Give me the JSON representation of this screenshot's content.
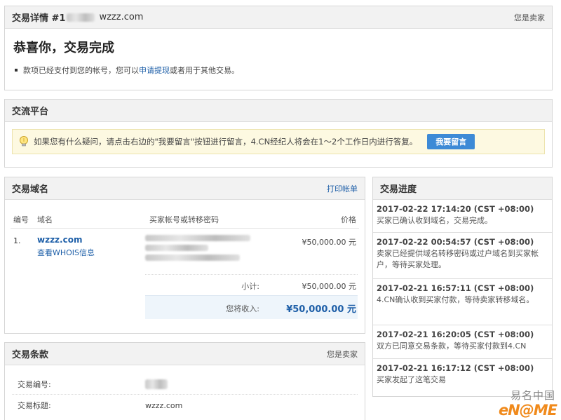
{
  "transaction": {
    "title_prefix": "交易详情 #1",
    "title_domain": "wzzz.com",
    "role": "您是卖家",
    "congrats": "恭喜你，交易完成",
    "note_before": "款项已经支付到您的帐号，您可以",
    "note_link": "申请提现",
    "note_after": "或者用于其他交易。"
  },
  "exchange": {
    "title": "交流平台",
    "notice": "如果您有什么疑问，请点击右边的\"我要留言\"按钮进行留言，4.CN经纪人将会在1～2个工作日内进行答复。",
    "button": "我要留言"
  },
  "domain_panel": {
    "title": "交易域名",
    "print_link": "打印帐单",
    "col_no": "编号",
    "col_domain": "域名",
    "col_buyer": "买家帐号或转移密码",
    "col_price": "价格",
    "row_no": "1.",
    "row_domain": "wzzz.com",
    "row_whois": "查看WHOIS信息",
    "row_price": "¥50,000.00 元",
    "subtotal_label": "小计:",
    "subtotal_value": "¥50,000.00 元",
    "receive_label": "您将收入:",
    "receive_value": "¥50,000.00 元"
  },
  "terms": {
    "title": "交易条款",
    "role": "您是卖家",
    "id_label": "交易编号:",
    "title_label": "交易标题:",
    "title_value": "wzzz.com"
  },
  "progress": {
    "title": "交易进度",
    "items": [
      {
        "time": "2017-02-22 17:14:20 (CST +08:00)",
        "text": "买家已确认收到域名，交易完成。"
      },
      {
        "time": "2017-02-22 00:54:57 (CST +08:00)",
        "text": "卖家已经提供域名转移密码或过户域名到买家帐户，等待买家处理。"
      },
      {
        "time": "2017-02-21 16:57:11 (CST +08:00)",
        "text": "4.CN确认收到买家付款，等待卖家转移域名。"
      },
      {
        "time": "2017-02-21 16:20:05 (CST +08:00)",
        "text": "双方已同意交易条款，等待买家付款到4.CN"
      },
      {
        "time": "2017-02-21 16:17:12 (CST +08:00)",
        "text": "买家发起了这笔交易"
      }
    ]
  },
  "watermark": {
    "cn": "易名中国",
    "logo": "eN@ME"
  },
  "colors": {
    "accent": "#1e5fa8",
    "button": "#3d8ad6",
    "notice_bg": "#fdf9e1",
    "watermark": "#f08a1c"
  }
}
